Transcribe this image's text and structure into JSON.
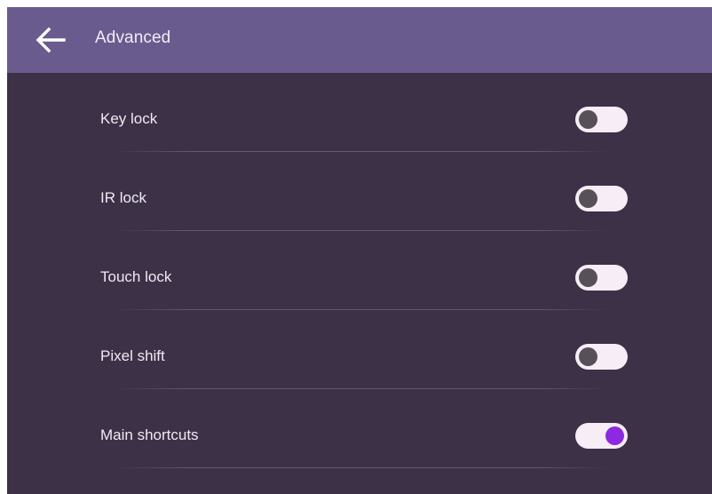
{
  "header": {
    "title": "Advanced",
    "back_icon": "arrow-left-icon"
  },
  "settings": [
    {
      "label": "Key lock",
      "enabled": false
    },
    {
      "label": "IR lock",
      "enabled": false
    },
    {
      "label": "Touch lock",
      "enabled": false
    },
    {
      "label": "Pixel shift",
      "enabled": false
    },
    {
      "label": "Main shortcuts",
      "enabled": true
    }
  ],
  "colors": {
    "header_bg": "#6a5b8e",
    "panel_bg": "#3d3148",
    "toggle_track": "#f6edf7",
    "toggle_off_knob": "#585058",
    "toggle_on_knob": "#8b2ae0"
  }
}
